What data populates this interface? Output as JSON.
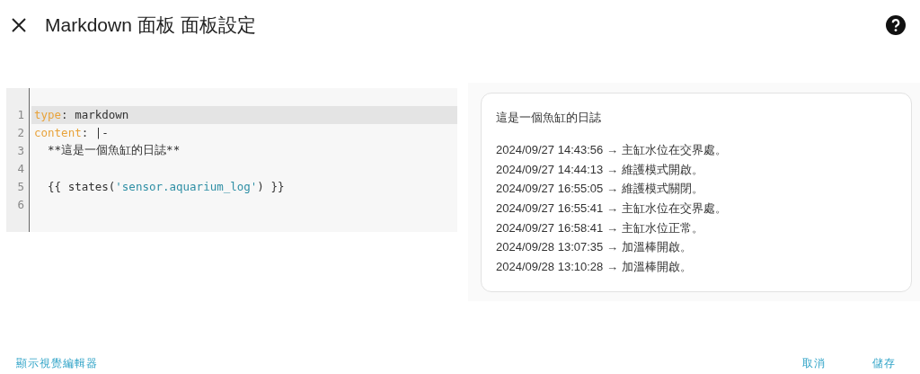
{
  "dialog": {
    "title": "Markdown 面板 面板設定"
  },
  "editor": {
    "lines": [
      {
        "number": "1",
        "active": true,
        "tokens": [
          {
            "kind": "key",
            "text": "type"
          },
          {
            "kind": "plain",
            "text": ": markdown"
          }
        ]
      },
      {
        "number": "2",
        "active": false,
        "tokens": [
          {
            "kind": "key",
            "text": "content"
          },
          {
            "kind": "plain",
            "text": ": |-"
          }
        ]
      },
      {
        "number": "3",
        "active": false,
        "tokens": [
          {
            "kind": "plain",
            "text": "  **這是一個魚缸的日誌**"
          }
        ]
      },
      {
        "number": "4",
        "active": false
      },
      {
        "number": "5",
        "active": false,
        "tokens": [
          {
            "kind": "plain",
            "text": "  {{ states("
          },
          {
            "kind": "string",
            "text": "'sensor.aquarium_log'"
          },
          {
            "kind": "plain",
            "text": ") }}"
          }
        ]
      },
      {
        "number": "6",
        "active": false
      }
    ]
  },
  "preview": {
    "heading": "這是一個魚缸的日誌",
    "entries": [
      "2024/09/27 14:43:56 → 主缸水位在交界處。",
      "2024/09/27 14:44:13 → 維護模式開啟。",
      "2024/09/27 16:55:05 → 維護模式關閉。",
      "2024/09/27 16:55:41 → 主缸水位在交界處。",
      "2024/09/27 16:58:41 → 主缸水位正常。",
      "2024/09/28 13:07:35 → 加溫棒開啟。",
      "2024/09/28 13:10:28 → 加溫棒開啟。"
    ]
  },
  "footer": {
    "toggle_link": "顯示視覺編輯器",
    "buttons": [
      "取消",
      "儲存"
    ]
  }
}
